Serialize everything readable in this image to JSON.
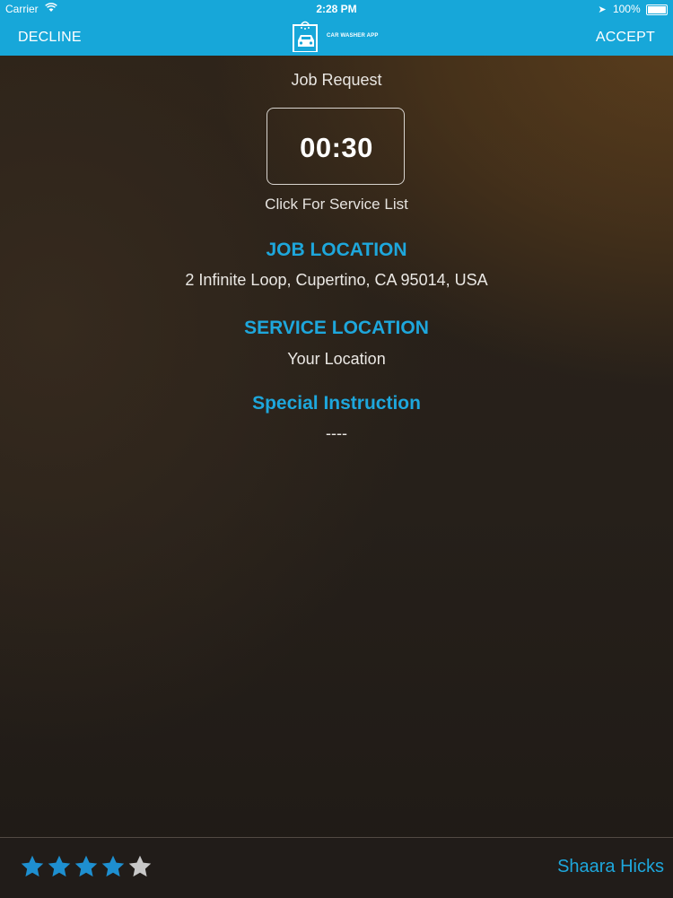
{
  "status_bar": {
    "carrier": "Carrier",
    "time": "2:28 PM",
    "battery": "100%",
    "icons": [
      "wifi-icon",
      "location-arrow-icon",
      "battery-icon"
    ]
  },
  "nav": {
    "decline_label": "DECLINE",
    "accept_label": "ACCEPT",
    "logo_text": "CAR WASHER APP",
    "logo_icon": "car-wash-icon"
  },
  "job": {
    "title": "Job Request",
    "timer": "00:30",
    "service_list_link": "Click For Service List",
    "job_location_heading": "JOB LOCATION",
    "job_location_value": "2 Infinite Loop,  Cupertino,  CA 95014,  USA",
    "service_location_heading": "SERVICE LOCATION",
    "service_location_value": "Your Location",
    "special_instruction_heading": "Special Instruction",
    "special_instruction_value": "----"
  },
  "footer": {
    "rating": 4,
    "rating_max": 5,
    "driver_name": "Shaara Hicks"
  },
  "colors": {
    "accent": "#17a7d9",
    "heading": "#1ea7dc",
    "star_filled": "#1e8fd0",
    "star_empty": "#c8c8c8"
  }
}
